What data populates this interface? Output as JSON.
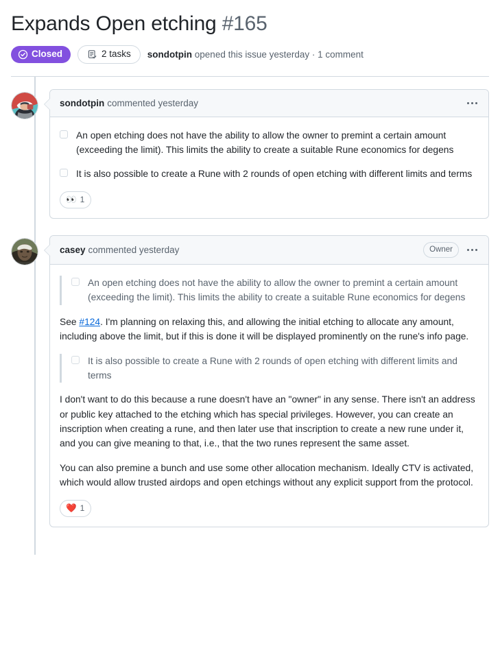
{
  "issue": {
    "title": "Expands Open etching",
    "number": "#165",
    "state_label": "Closed",
    "state_color": "#8250df",
    "tasks_label": "2 tasks",
    "meta_author": "sondotpin",
    "meta_rest": " opened this issue yesterday · 1 comment"
  },
  "comments": [
    {
      "author": "sondotpin",
      "action": "commented yesterday",
      "owner_badge": "",
      "reaction_emoji": "👀",
      "reaction_count": "1",
      "tasks": [
        "An open etching does not have the ability to allow the owner to premint a certain amount (exceeding the limit). This limits the ability to create a suitable Rune economics for degens",
        "It is also possible to create a Rune with 2 rounds of open etching with different limits and terms"
      ]
    },
    {
      "author": "casey",
      "action": "commented yesterday",
      "owner_badge": "Owner",
      "reaction_emoji": "❤️",
      "reaction_count": "1",
      "quote_one": "An open etching does not have the ability to allow the owner to premint a certain amount (exceeding the limit). This limits the ability to create a suitable Rune economics for degens",
      "quote_two": "It is also possible to create a Rune with 2 rounds of open etching with different limits and terms",
      "para_one_pre": "See ",
      "para_one_link": "#124",
      "para_one_post": ". I'm planning on relaxing this, and allowing the initial etching to allocate any amount, including above the limit, but if this is done it will be displayed prominently on the rune's info page.",
      "para_two": "I don't want to do this because a rune doesn't have an \"owner\" in any sense. There isn't an address or public key attached to the etching which has special privileges. However, you can create an inscription when creating a rune, and then later use that inscription to create a new rune under it, and you can give meaning to that, i.e., that the two runes represent the same asset.",
      "para_three": "You can also premine a bunch and use some other allocation mechanism. Ideally CTV is activated, which would allow trusted airdops and open etchings without any explicit support from the protocol."
    }
  ]
}
